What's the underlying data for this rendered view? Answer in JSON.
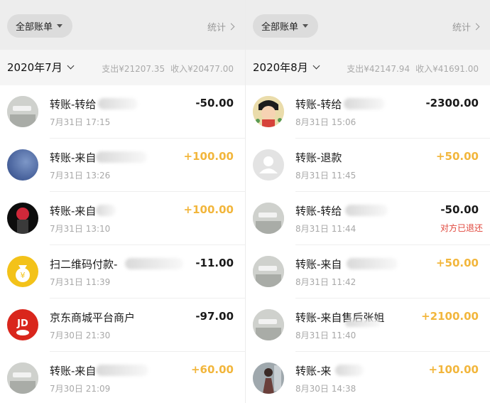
{
  "panels": [
    {
      "filter_label": "全部账单",
      "stats_label": "统计",
      "month": "2020年7月",
      "expense": "支出¥21207.35",
      "income": "收入¥20477.00",
      "rows": [
        {
          "title": "转账-转给",
          "time": "7月31日 17:15",
          "amount": "-50.00",
          "avatar": "room-avatar",
          "note": ""
        },
        {
          "title": "转账-来自",
          "time": "7月31日 13:26",
          "amount": "+100.00",
          "avatar": "sky-avatar",
          "note": ""
        },
        {
          "title": "转账-来自",
          "time": "7月31日 13:10",
          "amount": "+100.00",
          "avatar": "red-hood-avatar",
          "note": ""
        },
        {
          "title": "扫二维码付款-",
          "time": "7月31日 11:39",
          "amount": "-11.00",
          "avatar": "money-bag-icon",
          "note": ""
        },
        {
          "title": "京东商城平台商户",
          "time": "7月30日 21:30",
          "amount": "-97.00",
          "avatar": "jd-logo",
          "note": ""
        },
        {
          "title": "转账-来自",
          "time": "7月30日 21:09",
          "amount": "+60.00",
          "avatar": "room-avatar",
          "note": ""
        }
      ]
    },
    {
      "filter_label": "全部账单",
      "stats_label": "统计",
      "month": "2020年8月",
      "expense": "支出¥42147.94",
      "income": "收入¥41691.00",
      "rows": [
        {
          "title": "转账-转给",
          "time": "8月31日 15:06",
          "amount": "-2300.00",
          "avatar": "anime-avatar",
          "note": ""
        },
        {
          "title": "转账-退款",
          "time": "8月31日 11:45",
          "amount": "+50.00",
          "avatar": "default-user-icon",
          "note": ""
        },
        {
          "title": "转账-转给",
          "time": "8月31日 11:44",
          "amount": "-50.00",
          "avatar": "room-avatar",
          "note": "对方已退还"
        },
        {
          "title": "转账-来自",
          "time": "8月31日 11:42",
          "amount": "+50.00",
          "avatar": "room-avatar",
          "note": ""
        },
        {
          "title": "转账-来自售后张姐",
          "time": "8月31日 11:40",
          "amount": "+2100.00",
          "avatar": "room-avatar",
          "note": ""
        },
        {
          "title": "转账-来",
          "time": "8月30日 14:38",
          "amount": "+100.00",
          "avatar": "photo-avatar",
          "note": ""
        }
      ]
    }
  ]
}
